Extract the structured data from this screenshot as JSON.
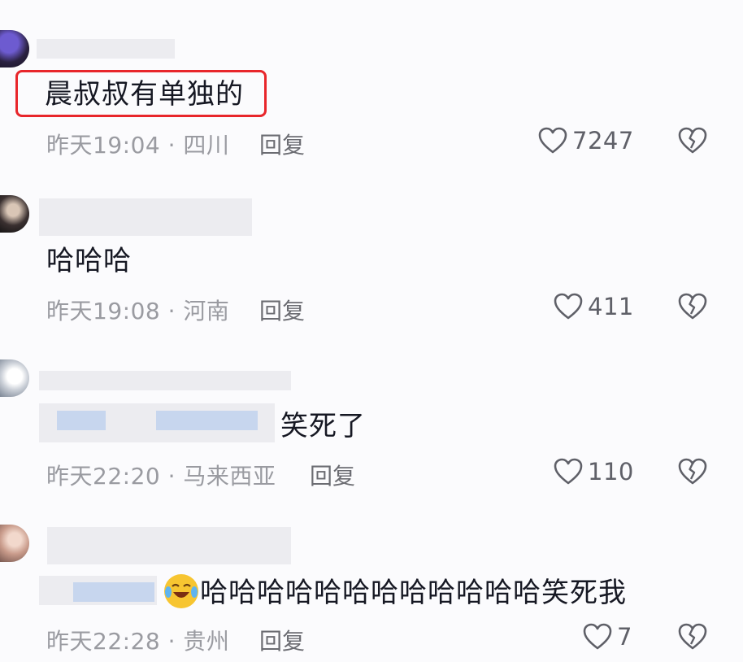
{
  "comments": [
    {
      "text": "晨叔叔有单独的",
      "time": "昨天19:04 · 四川",
      "reply": "回复",
      "likes": "7247"
    },
    {
      "text": "哈哈哈",
      "time": "昨天19:08 · 河南",
      "reply": "回复",
      "likes": "411"
    },
    {
      "text": "笑死了",
      "time": "昨天22:20 · 马来西亚",
      "reply": "回复",
      "likes": "110"
    },
    {
      "text": "哈哈哈哈哈哈哈哈哈哈哈哈笑死我",
      "time": "昨天22:28 · 贵州",
      "reply": "回复",
      "likes": "7"
    }
  ],
  "colors": {
    "highlight": "#e8262b",
    "meta": "#9a9ba1",
    "emoji": "#f7c531"
  },
  "icons": {
    "like": "heart-outline-icon",
    "dislike": "broken-heart-icon",
    "emoji": "laughing-crying-emoji"
  }
}
